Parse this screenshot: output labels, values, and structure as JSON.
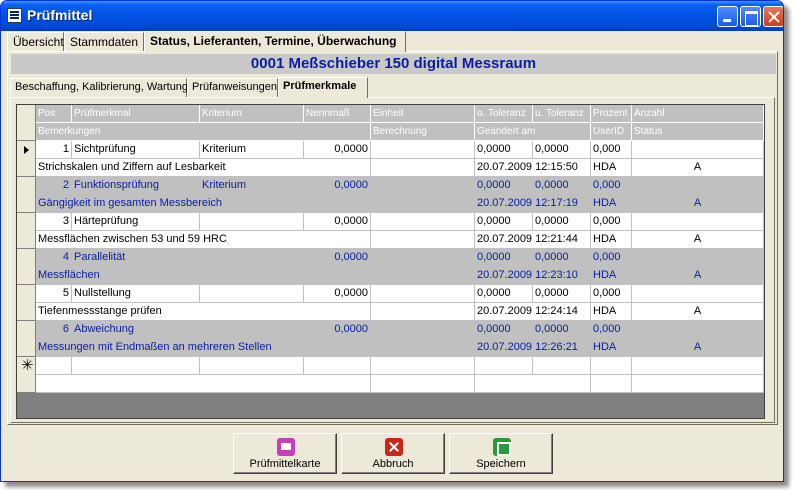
{
  "window": {
    "title": "Prüfmittel"
  },
  "main_tabs": [
    {
      "label": "Übersicht"
    },
    {
      "label": "Stammdaten"
    },
    {
      "label": "Status, Lieferanten, Termine, Überwachung"
    }
  ],
  "heading": "0001 Meßschieber 150 digital Messraum",
  "sub_tabs": [
    {
      "label": "Beschaffung, Kalibrierung, Wartung"
    },
    {
      "label": "Prüfanweisungen"
    },
    {
      "label": "Prüfmerkmale"
    }
  ],
  "grid": {
    "header1": [
      "Pos",
      "Prüfmerkmal",
      "Kriterium",
      "Nennmaß",
      "Einheit",
      "o. Toleranz",
      "u. Toleranz",
      "Prozent",
      "Anzahl"
    ],
    "header2": [
      "Bemerkungen",
      "Berechnung",
      "Geändert am",
      "UserID",
      "Status"
    ],
    "records": [
      {
        "pos": "1",
        "merkmal": "Sichtprüfung",
        "kriterium": "Kriterium",
        "nennmass": "0,0000",
        "einheit": "",
        "o_tol": "0,0000",
        "u_tol": "0,0000",
        "prozent": "0,000",
        "anzahl": "",
        "bemerkung": "Strichskalen und Ziffern auf Lesbarkeit",
        "berechnung": "",
        "geaendert": "20.07.2009 12:15:50",
        "userid": "HDA",
        "status": "A"
      },
      {
        "pos": "2",
        "merkmal": "Funktionsprüfung",
        "kriterium": "Kriterium",
        "nennmass": "0,0000",
        "einheit": "",
        "o_tol": "0,0000",
        "u_tol": "0,0000",
        "prozent": "0,000",
        "anzahl": "",
        "bemerkung": "Gängigkeit im gesamten Messbereich",
        "berechnung": "",
        "geaendert": "20.07.2009 12:17:19",
        "userid": "HDA",
        "status": "A"
      },
      {
        "pos": "3",
        "merkmal": "Härteprüfung",
        "kriterium": "",
        "nennmass": "0,0000",
        "einheit": "",
        "o_tol": "0,0000",
        "u_tol": "0,0000",
        "prozent": "0,000",
        "anzahl": "",
        "bemerkung": "Messflächen zwischen 53 und 59 HRC",
        "berechnung": "",
        "geaendert": "20.07.2009 12:21:44",
        "userid": "HDA",
        "status": "A"
      },
      {
        "pos": "4",
        "merkmal": "Parallelität",
        "kriterium": "",
        "nennmass": "0,0000",
        "einheit": "",
        "o_tol": "0,0000",
        "u_tol": "0,0000",
        "prozent": "0,000",
        "anzahl": "",
        "bemerkung": "Messflächen",
        "berechnung": "",
        "geaendert": "20.07.2009 12:23:10",
        "userid": "HDA",
        "status": "A"
      },
      {
        "pos": "5",
        "merkmal": "Nullstellung",
        "kriterium": "",
        "nennmass": "0,0000",
        "einheit": "",
        "o_tol": "0,0000",
        "u_tol": "0,0000",
        "prozent": "0,000",
        "anzahl": "",
        "bemerkung": "Tiefenmessstange prüfen",
        "berechnung": "",
        "geaendert": "20.07.2009 12:24:14",
        "userid": "HDA",
        "status": "A"
      },
      {
        "pos": "6",
        "merkmal": "Abweichung",
        "kriterium": "",
        "nennmass": "0,0000",
        "einheit": "",
        "o_tol": "0,0000",
        "u_tol": "0,0000",
        "prozent": "0,000",
        "anzahl": "",
        "bemerkung": "Messungen mit Endmaßen an mehreren Stellen",
        "berechnung": "",
        "geaendert": "20.07.2009 12:26:21",
        "userid": "HDA",
        "status": "A"
      }
    ]
  },
  "buttons": {
    "pruefmittelkarte": "Prüfmittelkarte",
    "abbruch": "Abbruch",
    "speichern": "Speichern"
  },
  "colors": {
    "band_gray": "#c0c0c0",
    "band_text": "#0a1e9e",
    "titlebar": "#0054e3"
  }
}
